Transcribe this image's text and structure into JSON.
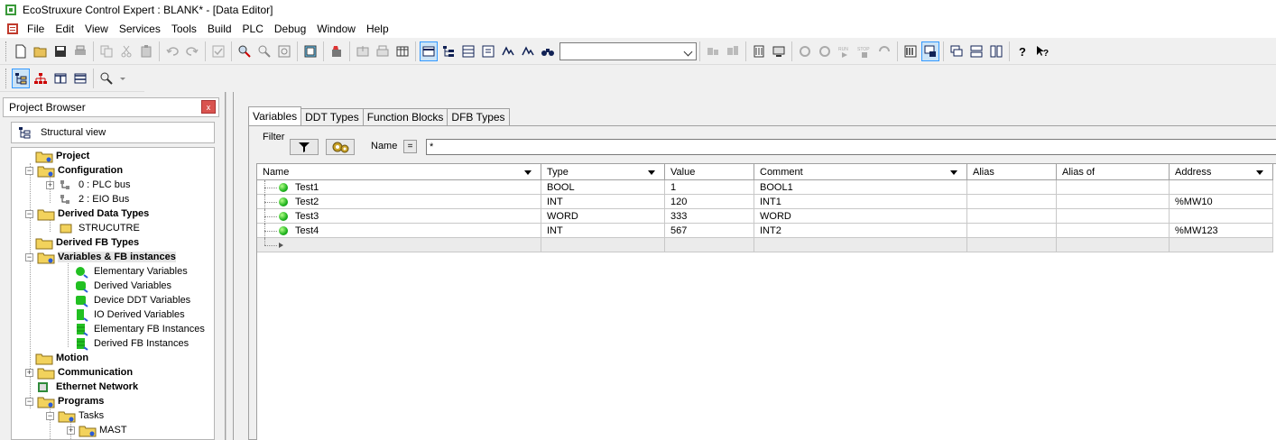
{
  "window": {
    "title": "EcoStruxure Control Expert : BLANK* - [Data Editor]"
  },
  "menu": [
    "File",
    "Edit",
    "View",
    "Services",
    "Tools",
    "Build",
    "PLC",
    "Debug",
    "Window",
    "Help"
  ],
  "toolbar": {
    "search_value": ""
  },
  "project_browser": {
    "title": "Project Browser",
    "close_label": "x",
    "view_label": "Structural view",
    "tree": [
      {
        "label": "Project",
        "bold": true
      },
      {
        "label": "Configuration",
        "bold": true
      },
      {
        "label": "0 : PLC bus",
        "bold": false
      },
      {
        "label": "2 : EIO Bus",
        "bold": false
      },
      {
        "label": "Derived Data Types",
        "bold": true
      },
      {
        "label": "STRUCUTRE",
        "bold": false
      },
      {
        "label": "Derived FB Types",
        "bold": true
      },
      {
        "label": "Variables & FB instances",
        "bold": true
      },
      {
        "label": "Elementary Variables",
        "bold": false
      },
      {
        "label": "Derived Variables",
        "bold": false
      },
      {
        "label": "Device DDT Variables",
        "bold": false
      },
      {
        "label": "IO Derived Variables",
        "bold": false
      },
      {
        "label": "Elementary FB Instances",
        "bold": false
      },
      {
        "label": "Derived FB Instances",
        "bold": false
      },
      {
        "label": "Motion",
        "bold": true
      },
      {
        "label": "Communication",
        "bold": true
      },
      {
        "label": "Ethernet Network",
        "bold": true
      },
      {
        "label": "Programs",
        "bold": true
      },
      {
        "label": "Tasks",
        "bold": false
      },
      {
        "label": "MAST",
        "bold": false
      }
    ]
  },
  "editor": {
    "tabs": [
      "Variables",
      "DDT Types",
      "Function Blocks",
      "DFB Types"
    ],
    "filter": {
      "label": "Filter",
      "name_label": "Name",
      "eq_label": "=",
      "name_value": "*"
    },
    "columns": [
      "Name",
      "Type",
      "Value",
      "Comment",
      "Alias",
      "Alias of",
      "Address"
    ],
    "rows": [
      {
        "name": "Test1",
        "type": "BOOL",
        "value": "1",
        "comment": "BOOL1",
        "alias": "",
        "alias_of": "",
        "address": ""
      },
      {
        "name": "Test2",
        "type": "INT",
        "value": "120",
        "comment": "INT1",
        "alias": "",
        "alias_of": "",
        "address": "%MW10"
      },
      {
        "name": "Test3",
        "type": "WORD",
        "value": "333",
        "comment": "WORD",
        "alias": "",
        "alias_of": "",
        "address": ""
      },
      {
        "name": "Test4",
        "type": "INT",
        "value": "567",
        "comment": "INT2",
        "alias": "",
        "alias_of": "",
        "address": "%MW123"
      }
    ]
  }
}
